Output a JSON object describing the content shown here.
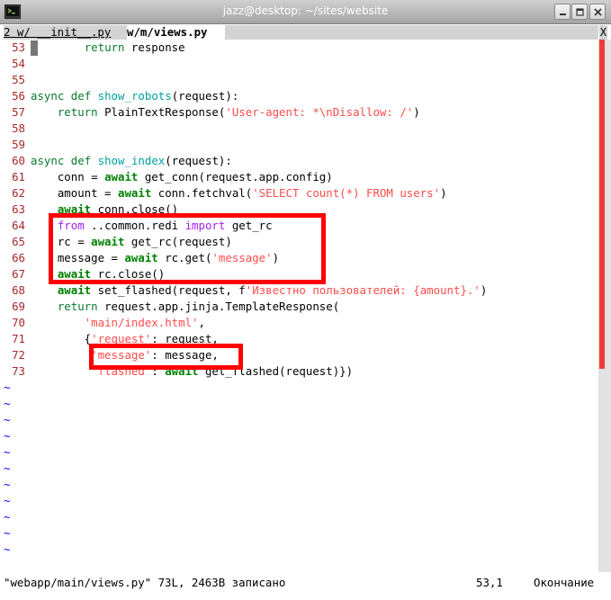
{
  "window": {
    "title": "jazz@desktop: ~/sites/website"
  },
  "tabs": {
    "inactive_label": "2 w/ __init__.py",
    "active_label": "w/m/views.py",
    "close_label": "X"
  },
  "lines": [
    {
      "n": "53",
      "tokens": [
        [
          "plain",
          "        "
        ],
        [
          "ctrl",
          "return"
        ],
        [
          "plain",
          " response"
        ]
      ]
    },
    {
      "n": "54",
      "tokens": []
    },
    {
      "n": "55",
      "tokens": []
    },
    {
      "n": "56",
      "tokens": [
        [
          "ctrl",
          "async"
        ],
        [
          "plain",
          " "
        ],
        [
          "ctrl",
          "def"
        ],
        [
          "plain",
          " "
        ],
        [
          "func",
          "show_robots"
        ],
        [
          "plain",
          "(request):"
        ]
      ]
    },
    {
      "n": "57",
      "tokens": [
        [
          "plain",
          "    "
        ],
        [
          "ctrl",
          "return"
        ],
        [
          "plain",
          " PlainTextResponse("
        ],
        [
          "str",
          "'User-agent: *\\nDisallow: /'"
        ],
        [
          "plain",
          ")"
        ]
      ]
    },
    {
      "n": "58",
      "tokens": []
    },
    {
      "n": "59",
      "tokens": []
    },
    {
      "n": "60",
      "tokens": [
        [
          "ctrl",
          "async"
        ],
        [
          "plain",
          " "
        ],
        [
          "ctrl",
          "def"
        ],
        [
          "plain",
          " "
        ],
        [
          "func",
          "show_index"
        ],
        [
          "plain",
          "(request):"
        ]
      ]
    },
    {
      "n": "61",
      "tokens": [
        [
          "plain",
          "    conn = "
        ],
        [
          "kw",
          "await"
        ],
        [
          "plain",
          " get_conn(request.app.config)"
        ]
      ]
    },
    {
      "n": "62",
      "tokens": [
        [
          "plain",
          "    amount = "
        ],
        [
          "kw",
          "await"
        ],
        [
          "plain",
          " conn.fetchval("
        ],
        [
          "str",
          "'SELECT count(*) FROM users'"
        ],
        [
          "plain",
          ")"
        ]
      ]
    },
    {
      "n": "63",
      "tokens": [
        [
          "plain",
          "    "
        ],
        [
          "kw",
          "await"
        ],
        [
          "plain",
          " conn.close()"
        ]
      ]
    },
    {
      "n": "64",
      "tokens": [
        [
          "plain",
          "    "
        ],
        [
          "imp",
          "from"
        ],
        [
          "plain",
          " ..common.redi "
        ],
        [
          "imp",
          "import"
        ],
        [
          "plain",
          " get_rc"
        ]
      ]
    },
    {
      "n": "65",
      "tokens": [
        [
          "plain",
          "    rc = "
        ],
        [
          "kw",
          "await"
        ],
        [
          "plain",
          " get_rc(request)"
        ]
      ]
    },
    {
      "n": "66",
      "tokens": [
        [
          "plain",
          "    message = "
        ],
        [
          "kw",
          "await"
        ],
        [
          "plain",
          " rc.get("
        ],
        [
          "str",
          "'message'"
        ],
        [
          "plain",
          ")"
        ]
      ]
    },
    {
      "n": "67",
      "tokens": [
        [
          "plain",
          "    "
        ],
        [
          "kw",
          "await"
        ],
        [
          "plain",
          " rc.close()"
        ]
      ]
    },
    {
      "n": "68",
      "tokens": [
        [
          "plain",
          "    "
        ],
        [
          "kw",
          "await"
        ],
        [
          "plain",
          " set_flashed(request, f"
        ],
        [
          "str",
          "'Известно пользователей: {amount}.'"
        ],
        [
          "plain",
          ")"
        ]
      ]
    },
    {
      "n": "69",
      "tokens": [
        [
          "plain",
          "    "
        ],
        [
          "ctrl",
          "return"
        ],
        [
          "plain",
          " request.app.jinja.TemplateResponse("
        ]
      ]
    },
    {
      "n": "70",
      "tokens": [
        [
          "plain",
          "        "
        ],
        [
          "str",
          "'main/index.html'"
        ],
        [
          "plain",
          ","
        ]
      ]
    },
    {
      "n": "71",
      "tokens": [
        [
          "plain",
          "        {"
        ],
        [
          "str",
          "'request'"
        ],
        [
          "plain",
          ": request,"
        ]
      ]
    },
    {
      "n": "72",
      "tokens": [
        [
          "plain",
          "         "
        ],
        [
          "str",
          "'message'"
        ],
        [
          "plain",
          ": message,"
        ]
      ]
    },
    {
      "n": "73",
      "tokens": [
        [
          "plain",
          "         "
        ],
        [
          "str",
          "'flashed'"
        ],
        [
          "plain",
          ": "
        ],
        [
          "kw",
          "await"
        ],
        [
          "plain",
          " get_flashed(request)})"
        ]
      ]
    }
  ],
  "filler_char": "~",
  "status": {
    "message": "\"webapp/main/views.py\" 73L, 2463B записано",
    "position": "53,1",
    "scroll": "Окончание"
  },
  "colors": {
    "keyword": "#008000",
    "string": "#ff4b4b",
    "function": "#00a0a0",
    "import": "#a020f0",
    "line_number": "#a52a2a",
    "tilde": "#0000ff",
    "highlight_box": "#ff0000",
    "scrollbar_thumb": "#ef3b3b"
  }
}
